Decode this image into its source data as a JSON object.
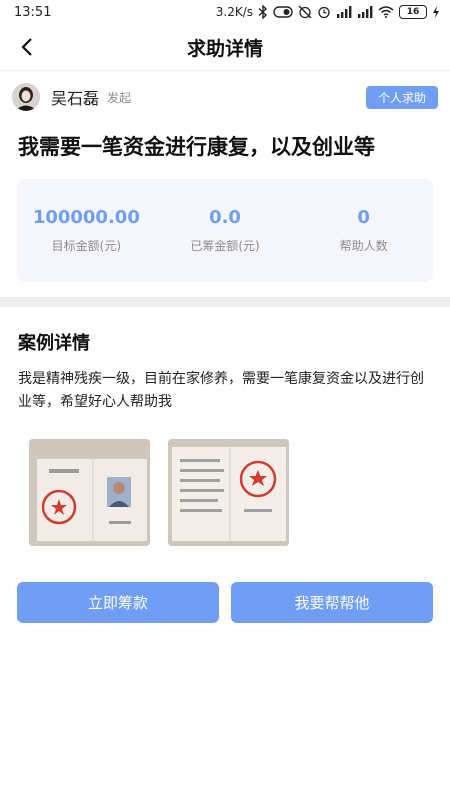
{
  "status_bar": {
    "time": "13:51",
    "speed": "3.2K/s",
    "battery": "16",
    "icons": [
      "bluetooth-icon",
      "toggle-icon",
      "alarm-mute-icon",
      "alarm-icon",
      "signal-icon",
      "hd-signal-icon",
      "wifi-icon",
      "battery-icon",
      "charging-icon"
    ]
  },
  "nav": {
    "title": "求助详情",
    "back_icon": "back-arrow-icon"
  },
  "author": {
    "name": "吴石磊",
    "action": "发起",
    "tag": "个人求助"
  },
  "title": "我需要一笔资金进行康复，以及创业等",
  "stats": [
    {
      "value": "100000.00",
      "label": "目标金额(元)"
    },
    {
      "value": "0.0",
      "label": "已筹金额(元)"
    },
    {
      "value": "0",
      "label": "帮助人数"
    }
  ],
  "case": {
    "title": "案例详情",
    "description": "我是精神残疾一级，目前在家修养，需要一笔康复资金以及进行创业等，希望好心人帮助我",
    "photos": [
      "disability-certificate-photo-1",
      "disability-certificate-photo-2"
    ]
  },
  "buttons": {
    "raise": "立即筹款",
    "help": "我要帮帮他"
  },
  "colors": {
    "accent": "#6f9ef4",
    "stats_bg": "#f4f6fb",
    "divider": "#efefef"
  }
}
